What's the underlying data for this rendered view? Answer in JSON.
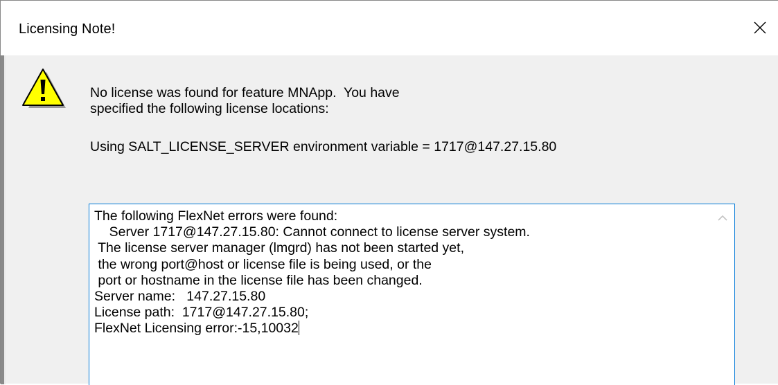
{
  "window": {
    "title": "Licensing Note!"
  },
  "icons": {
    "warning": "warning-icon",
    "close": "close-icon",
    "scroll_up": "chevron-up-icon"
  },
  "message": {
    "line1": "No license was found for feature MNApp.  You have",
    "line2": "specified the following license locations:",
    "line3": "Using SALT_LICENSE_SERVER environment variable = 1717@147.27.15.80"
  },
  "error_box": {
    "lines": [
      "The following FlexNet errors were found:",
      "    Server 1717@147.27.15.80: Cannot connect to license server system.",
      " The license server manager (lmgrd) has not been started yet,",
      " the wrong port@host or license file is being used, or the",
      " port or hostname in the license file has been changed.",
      "Server name:   147.27.15.80",
      "License path:  1717@147.27.15.80;",
      "FlexNet Licensing error:-15,10032"
    ]
  },
  "colors": {
    "focus_border": "#0078d7",
    "dialog_bg": "#f0f0f0",
    "warning_yellow": "#ffff00"
  }
}
